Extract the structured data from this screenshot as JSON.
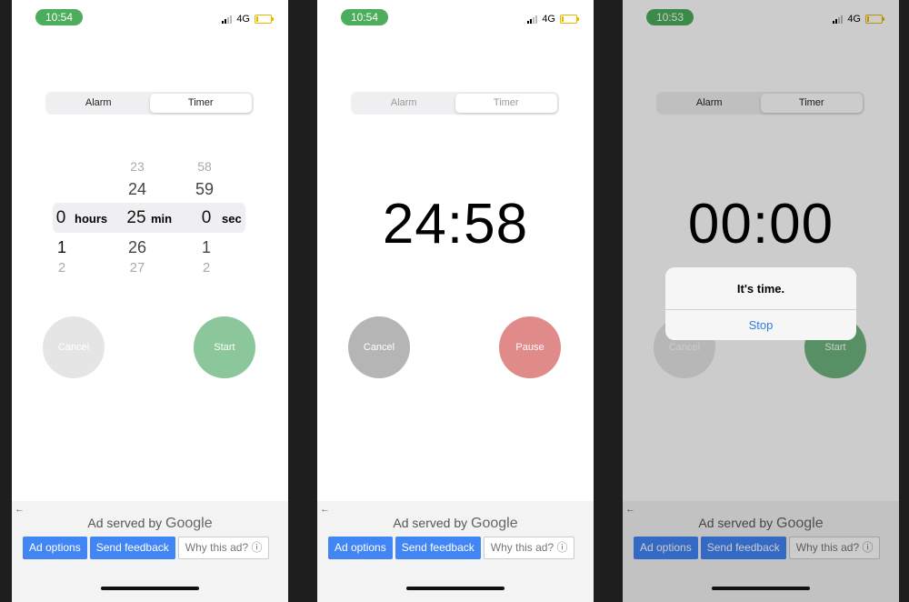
{
  "screens": [
    {
      "status": {
        "time": "10:54",
        "network": "4G"
      },
      "tabs": {
        "alarm": "Alarm",
        "timer": "Timer"
      },
      "picker": {
        "hours": {
          "above3": "",
          "above2": "",
          "above1": "",
          "selected": "0",
          "below1": "1",
          "below2": "2",
          "below3": ""
        },
        "minutes": {
          "above3": "",
          "above2": "23",
          "above1": "24",
          "selected": "25",
          "below1": "26",
          "below2": "27",
          "below3": ""
        },
        "seconds": {
          "above3": "",
          "above2": "58",
          "above1": "59",
          "selected": "0",
          "below1": "1",
          "below2": "2",
          "below3": ""
        },
        "units": {
          "hours": "hours",
          "minutes": "min",
          "seconds": "sec"
        }
      },
      "left_button": "Cancel",
      "right_button": "Start",
      "ad": {
        "served_by": "Ad served by",
        "google": "Google",
        "options": "Ad options",
        "feedback": "Send feedback",
        "why": "Why this ad? ⓘ"
      }
    },
    {
      "status": {
        "time": "10:54",
        "network": "4G"
      },
      "tabs": {
        "alarm": "Alarm",
        "timer": "Timer"
      },
      "countdown": "24:58",
      "left_button": "Cancel",
      "right_button": "Pause",
      "ad": {
        "served_by": "Ad served by",
        "google": "Google",
        "options": "Ad options",
        "feedback": "Send feedback",
        "why": "Why this ad? ⓘ"
      }
    },
    {
      "status": {
        "time": "10:53",
        "network": "4G"
      },
      "tabs": {
        "alarm": "Alarm",
        "timer": "Timer"
      },
      "countdown": "00:00",
      "left_button": "Cancel",
      "right_button": "Start",
      "alert": {
        "title": "It's time.",
        "action": "Stop"
      },
      "ad": {
        "served_by": "Ad served by",
        "google": "Google",
        "options": "Ad options",
        "feedback": "Send feedback",
        "why": "Why this ad? ⓘ"
      }
    }
  ],
  "colors": {
    "status_pill": "#4cad5c",
    "start_green": "#8cc79b",
    "pause_red": "#e08a8a",
    "cancel_gray_disabled": "#e5e5e5",
    "cancel_gray": "#b5b5b5",
    "ad_blue": "#4285f4",
    "alert_link": "#2e7be5"
  }
}
